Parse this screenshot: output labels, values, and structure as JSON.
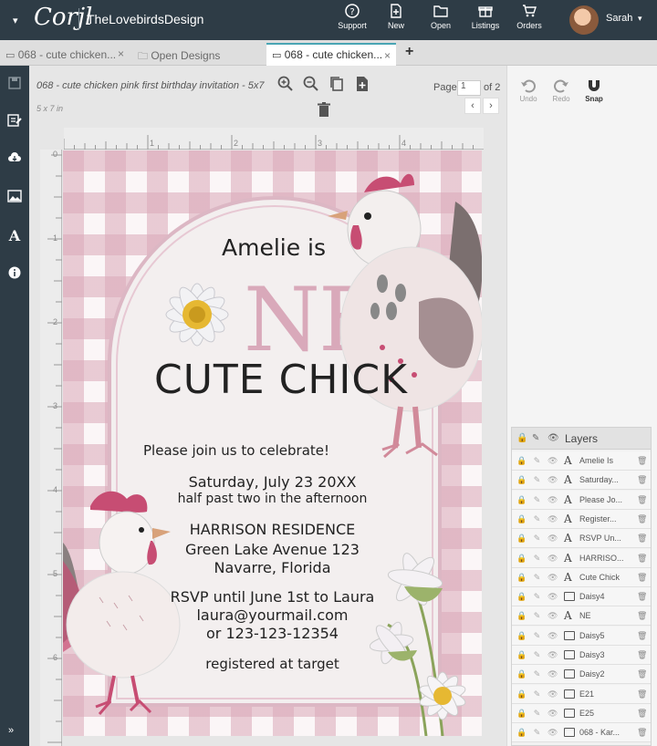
{
  "topbar": {
    "logo": "Corjl",
    "brand": "TheLovebirdsDesign",
    "nav": [
      {
        "label": "Support",
        "icon": "question-circle-icon"
      },
      {
        "label": "New",
        "icon": "new-file-icon"
      },
      {
        "label": "Open",
        "icon": "folder-icon"
      },
      {
        "label": "Listings",
        "icon": "gift-box-icon"
      },
      {
        "label": "Orders",
        "icon": "cart-icon"
      }
    ],
    "user": "Sarah"
  },
  "tabs": [
    {
      "label": "068 - cute chicken...",
      "close": "×"
    },
    {
      "label": "Open Designs"
    },
    {
      "label": "068 - cute chicken...",
      "close": "×"
    }
  ],
  "add_tab": "+",
  "document": {
    "title": "068 - cute chicken pink first birthday invitation - 5x7",
    "size": "5 x 7 in"
  },
  "pager": {
    "label": "Page",
    "current": "1",
    "of": "of 2",
    "prev": "‹",
    "next": "›"
  },
  "right_tools": [
    {
      "label": "Undo",
      "icon": "undo-icon"
    },
    {
      "label": "Redo",
      "icon": "redo-icon"
    },
    {
      "label": "Snap",
      "icon": "magnet-icon"
    }
  ],
  "ruler": {
    "h": [
      "1",
      "2",
      "3",
      "4"
    ],
    "v": [
      "1",
      "2",
      "3",
      "4",
      "5",
      "6"
    ],
    "zero": "0"
  },
  "invitation": {
    "name": "Amelie is",
    "big": "NE",
    "cute": "CUTE CHICK",
    "join": "Please join us to celebrate!",
    "date": "Saturday, July 23 20XX",
    "time": "half past two in the afternoon",
    "residence": "HARRISON RESIDENCE",
    "street": "Green Lake Avenue 123",
    "city": "Navarre, Florida",
    "rsvp": "RSVP until June 1st to Laura",
    "email": "laura@yourmail.com",
    "phone": "or 123-123-12354",
    "registry": "registered at target"
  },
  "layers": {
    "title": "Layers",
    "items": [
      {
        "name": "Amelie Is",
        "type": "text"
      },
      {
        "name": "Saturday...",
        "type": "text"
      },
      {
        "name": "Please Jo...",
        "type": "text"
      },
      {
        "name": "Register...",
        "type": "text"
      },
      {
        "name": "RSVP Un...",
        "type": "text"
      },
      {
        "name": "HARRISO...",
        "type": "text"
      },
      {
        "name": "Cute Chick",
        "type": "text"
      },
      {
        "name": "Daisy4",
        "type": "image"
      },
      {
        "name": "NE",
        "type": "text"
      },
      {
        "name": "Daisy5",
        "type": "image"
      },
      {
        "name": "Daisy3",
        "type": "image"
      },
      {
        "name": "Daisy2",
        "type": "image"
      },
      {
        "name": "E21",
        "type": "image"
      },
      {
        "name": "E25",
        "type": "image"
      },
      {
        "name": "068 - Kar...",
        "type": "image"
      }
    ],
    "text_glyph": "A"
  },
  "colors": {
    "topbar": "#2e3c46",
    "gingham": "#daa8b8",
    "accent": "#4aa5b4",
    "ne": "#d9a9ba"
  }
}
